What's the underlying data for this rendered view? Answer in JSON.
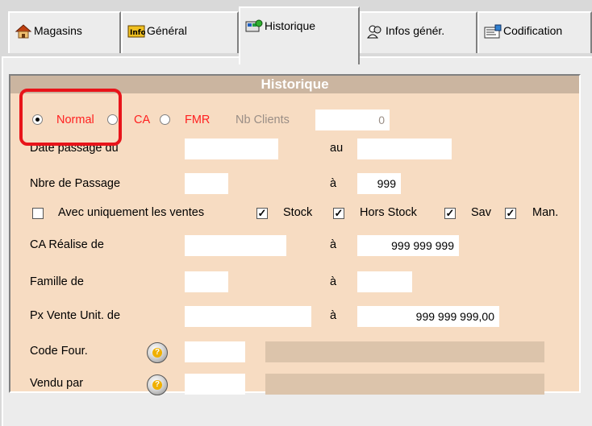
{
  "tabs": [
    {
      "label": "Magasins",
      "icon": "house-icon"
    },
    {
      "label": "Général",
      "icon": "info-icon"
    },
    {
      "label": "Historique",
      "icon": "history-icon"
    },
    {
      "label": "Infos génér.",
      "icon": "people-icon"
    },
    {
      "label": "Codification",
      "icon": "barcode-icon"
    }
  ],
  "group": {
    "title": "Historique"
  },
  "mode": {
    "normal": "Normal",
    "ca": "CA",
    "fmr": "FMR",
    "nb_clients": "Nb Clients",
    "nb_clients_value": "0"
  },
  "rows": {
    "date_passage": {
      "label": "Date passage du",
      "sep": "au",
      "from": "",
      "to": ""
    },
    "nbre_passage": {
      "label": "Nbre de Passage",
      "sep": "à",
      "from": "",
      "to": "999"
    },
    "avec_ventes": {
      "label": "Avec uniquement les ventes"
    },
    "stock": "Stock",
    "hors_stock": "Hors Stock",
    "sav": "Sav",
    "man": "Man.",
    "ca_realise": {
      "label": "CA Réalise de",
      "sep": "à",
      "from": "",
      "to": "999 999 999"
    },
    "famille": {
      "label": "Famille de",
      "sep": "à",
      "from": "",
      "to": ""
    },
    "px_vente": {
      "label": "Px Vente Unit. de",
      "sep": "à",
      "from": "",
      "to": "999 999 999,00"
    },
    "code_four": {
      "label": "Code Four.",
      "help": "?"
    },
    "vendu_par": {
      "label": "Vendu par",
      "help": "?"
    }
  },
  "colors": {
    "highlight": "#e8141a",
    "group_bg": "#f7dcc2",
    "title_bg": "#cbb5a0"
  }
}
